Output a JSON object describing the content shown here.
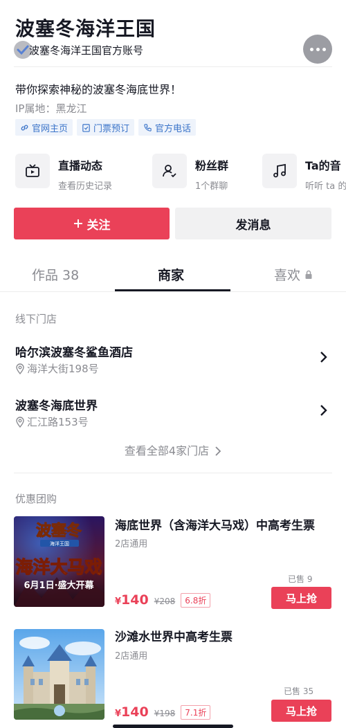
{
  "header": {
    "title": "波塞冬海洋王国",
    "subtitle": "波塞冬海洋王国官方账号"
  },
  "profile": {
    "bio": "带你探索神秘的波塞冬海底世界！",
    "ip_location": "IP属地：黑龙江",
    "tags": [
      {
        "label": "官网主页",
        "icon": "link-icon"
      },
      {
        "label": "门票预订",
        "icon": "ticket-icon"
      },
      {
        "label": "官方电话",
        "icon": "phone-icon"
      }
    ]
  },
  "features": [
    {
      "title": "直播动态",
      "sub": "查看历史记录",
      "icon": "tv-icon"
    },
    {
      "title": "粉丝群",
      "sub": "1个群聊",
      "icon": "fans-group-icon"
    },
    {
      "title": "Ta的音",
      "sub": "听听 ta 的",
      "icon": "music-icon"
    }
  ],
  "actions": {
    "follow": "关注",
    "message": "发消息"
  },
  "tabs": [
    {
      "label": "作品 38",
      "active": false
    },
    {
      "label": "商家",
      "active": true
    },
    {
      "label": "喜欢",
      "active": false,
      "icon": "lock-icon"
    }
  ],
  "stores": {
    "section_label": "线下门店",
    "items": [
      {
        "name": "哈尔滨波塞冬鲨鱼酒店",
        "address": "海洋大街198号"
      },
      {
        "name": "波塞冬海底世界",
        "address": "汇江路153号"
      }
    ],
    "view_all": "查看全部4家门店"
  },
  "deals": {
    "section_label": "优惠团购",
    "items": [
      {
        "name": "海底世界（含海洋大马戏）中高考生票",
        "sub": "2店通用",
        "currency": "¥",
        "price": "140",
        "original": "¥208",
        "discount": "6.8折",
        "sold": "已售 9",
        "button": "马上抢",
        "poster_top": "波塞冬",
        "poster_banner": "海洋王国",
        "poster_main": "海洋大马戏",
        "poster_date": "6月1日·盛大开幕"
      },
      {
        "name": "沙滩水世界中高考生票",
        "sub": "2店通用",
        "currency": "¥",
        "price": "140",
        "original": "¥198",
        "discount": "7.1折",
        "sold": "已售 35",
        "button": "马上抢"
      }
    ]
  },
  "colors": {
    "accent": "#ea4158",
    "link": "#3b74c9",
    "muted": "#8a8b91"
  }
}
